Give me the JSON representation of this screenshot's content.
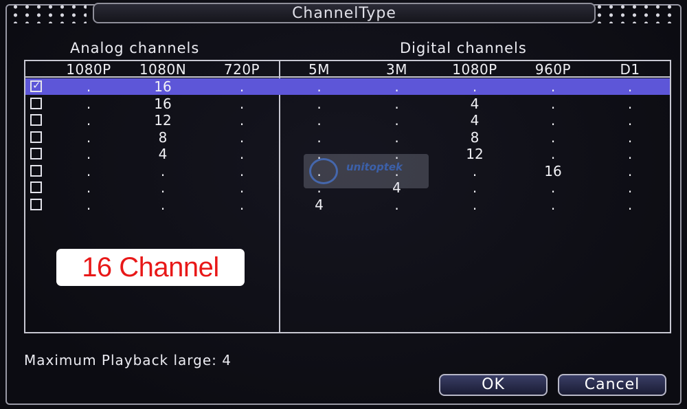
{
  "dialog": {
    "title": "ChannelType"
  },
  "sections": {
    "analog_title": "Analog channels",
    "digital_title": "Digital channels"
  },
  "columns": {
    "analog": [
      "1080P",
      "1080N",
      "720P"
    ],
    "digital": [
      "5M",
      "3M",
      "1080P",
      "960P",
      "D1"
    ]
  },
  "rows": [
    {
      "checked": true,
      "selected": true,
      "analog": [
        ".",
        "16",
        "."
      ],
      "digital": [
        ".",
        ".",
        ".",
        ".",
        "."
      ]
    },
    {
      "checked": false,
      "selected": false,
      "analog": [
        ".",
        "16",
        "."
      ],
      "digital": [
        ".",
        ".",
        "4",
        ".",
        "."
      ]
    },
    {
      "checked": false,
      "selected": false,
      "analog": [
        ".",
        "12",
        "."
      ],
      "digital": [
        ".",
        ".",
        "4",
        ".",
        "."
      ]
    },
    {
      "checked": false,
      "selected": false,
      "analog": [
        ".",
        "8",
        "."
      ],
      "digital": [
        ".",
        ".",
        "8",
        ".",
        "."
      ]
    },
    {
      "checked": false,
      "selected": false,
      "analog": [
        ".",
        "4",
        "."
      ],
      "digital": [
        ".",
        ".",
        "12",
        ".",
        "."
      ]
    },
    {
      "checked": false,
      "selected": false,
      "analog": [
        ".",
        ".",
        "."
      ],
      "digital": [
        ".",
        ".",
        ".",
        "16",
        "."
      ]
    },
    {
      "checked": false,
      "selected": false,
      "analog": [
        ".",
        ".",
        "."
      ],
      "digital": [
        ".",
        "4",
        ".",
        ".",
        "."
      ]
    },
    {
      "checked": false,
      "selected": false,
      "analog": [
        ".",
        ".",
        "."
      ],
      "digital": [
        "4",
        ".",
        ".",
        ".",
        "."
      ]
    }
  ],
  "watermark": {
    "text": "unitoptek"
  },
  "promo": {
    "label": "16 Channel"
  },
  "footer": {
    "playback": "Maximum Playback large: 4"
  },
  "buttons": {
    "ok": "OK",
    "cancel": "Cancel"
  },
  "colors": {
    "selected_row": "#5d56d8",
    "promo_text": "#e81818",
    "background": "#101018"
  }
}
